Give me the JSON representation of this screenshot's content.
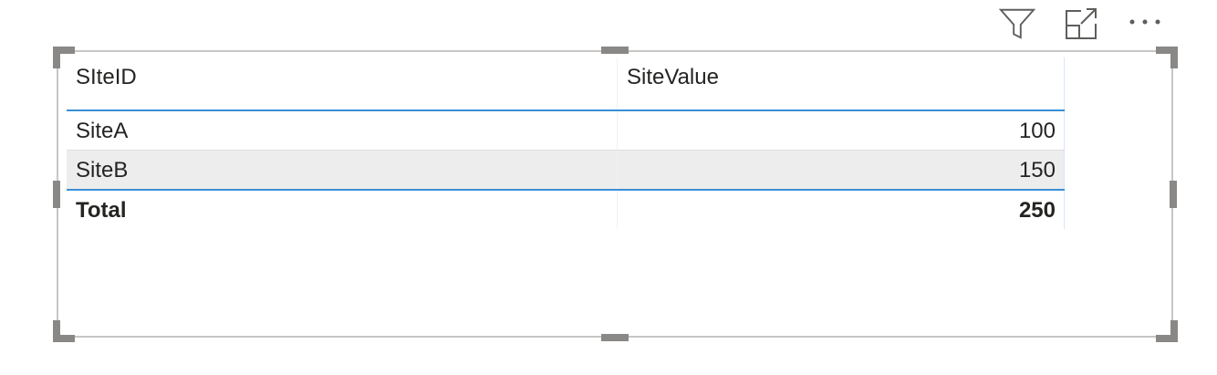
{
  "toolbar": {
    "filter_icon": "filter-icon",
    "focus_mode_icon": "focus-mode-icon",
    "more_options_icon": "more-options-icon"
  },
  "table": {
    "columns": [
      "SIteID",
      "SiteValue"
    ],
    "rows": [
      {
        "site": "SiteA",
        "value": "100"
      },
      {
        "site": "SiteB",
        "value": "150"
      }
    ],
    "total": {
      "label": "Total",
      "value": "250"
    }
  },
  "colors": {
    "accent": "#3a8fd6",
    "frame": "#c8c6c4",
    "handle": "#8a8886",
    "alt_row": "#ededed"
  }
}
